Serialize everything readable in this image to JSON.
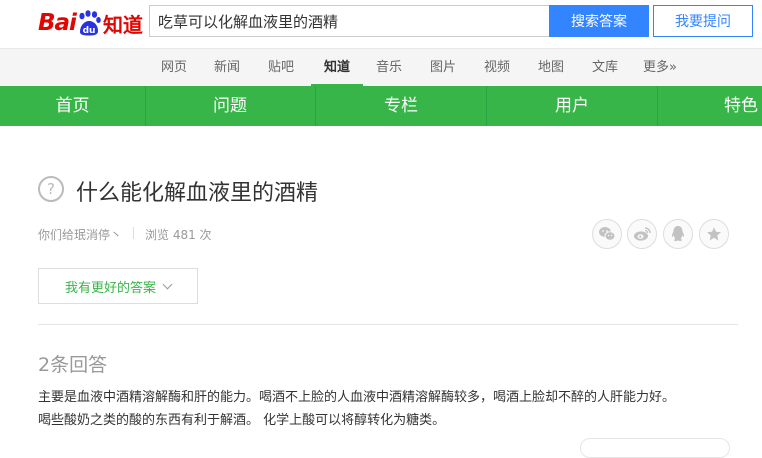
{
  "header": {
    "logo_bai": "Bai",
    "logo_zhidao": "知道",
    "search_value": "吃草可以化解血液里的酒精",
    "search_button": "搜索答案",
    "ask_button": "我要提问"
  },
  "product_nav": {
    "items": [
      "网页",
      "新闻",
      "贴吧",
      "知道",
      "音乐",
      "图片",
      "视频",
      "地图",
      "文库",
      "更多»"
    ],
    "active": "知道"
  },
  "green_nav": {
    "items": [
      "首页",
      "问题",
      "专栏",
      "用户",
      "特色"
    ]
  },
  "question": {
    "title": "什么能化解血液里的酒精",
    "user": "你们给珉消停丶",
    "views": "浏览 481 次"
  },
  "share_icons": [
    "wechat-icon",
    "weibo-icon",
    "qq-icon",
    "favorite-star-icon"
  ],
  "better_answer_button": "我有更好的答案",
  "answers": {
    "count_label": "2条回答",
    "first_answer_line1": "主要是血液中酒精溶解酶和肝的能力。喝酒不上脸的人血液中酒精溶解酶较多，喝酒上脸却不醉的人肝能力好。",
    "first_answer_line2": "喝些酸奶之类的酸的东西有利于解酒。 化学上酸可以将醇转化为糖类。"
  },
  "colors": {
    "brand_red": "#e10601",
    "brand_blue": "#3385ff",
    "nav_green": "#38b549"
  }
}
